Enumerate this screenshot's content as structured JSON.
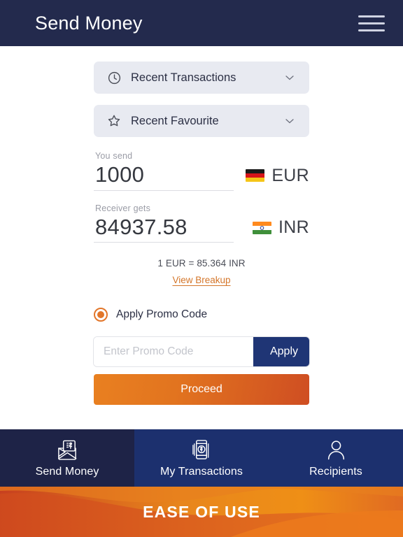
{
  "header": {
    "title": "Send Money",
    "menu_icon": "hamburger-menu-icon"
  },
  "quick_access": [
    {
      "label": "Recent Transactions",
      "icon": "clock-icon",
      "chevron": "chevron-down-icon"
    },
    {
      "label": "Recent Favourite",
      "icon": "star-icon",
      "chevron": "chevron-down-icon"
    }
  ],
  "send": {
    "label": "You send",
    "amount": "1000",
    "currency_code": "EUR",
    "flag": "germany-flag-icon"
  },
  "receive": {
    "label": "Receiver gets",
    "amount": "84937.58",
    "currency_code": "INR",
    "flag": "india-flag-icon"
  },
  "rate": {
    "text": "1 EUR = 85.364 INR",
    "breakup_link": "View Breakup"
  },
  "promo": {
    "radio_label": "Apply Promo Code",
    "placeholder": "Enter Promo Code",
    "value": "",
    "apply_label": "Apply"
  },
  "proceed_label": "Proceed",
  "bottom_nav": [
    {
      "label": "Send Money",
      "icon": "envelope-money-icon",
      "active": true
    },
    {
      "label": "My Transactions",
      "icon": "mobile-payment-icon",
      "active": false
    },
    {
      "label": "Recipients",
      "icon": "person-icon",
      "active": false
    }
  ],
  "banner": {
    "text": "EASE OF USE"
  },
  "colors": {
    "header_navy": "#232a4d",
    "nav_blue": "#1c306e",
    "nav_active": "#1e2347",
    "accent_orange": "#e2762a",
    "apply_navy": "#1f3575",
    "link_orange": "#d4762a"
  }
}
